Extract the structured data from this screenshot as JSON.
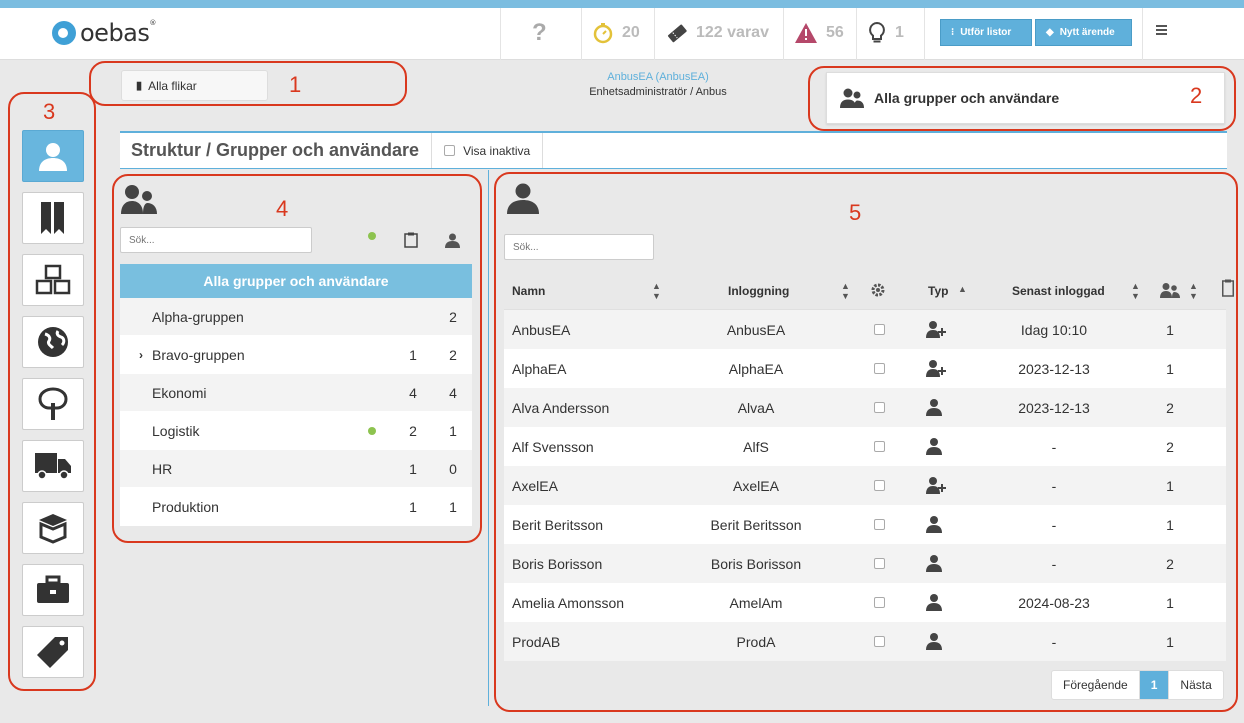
{
  "header": {
    "logo_text": "oebas",
    "logo_mark": "®",
    "help": "?",
    "timer_count": "20",
    "tickets": "122 varav",
    "alerts_count": "56",
    "ideas_count": "1",
    "btn_lists": "Utför listor",
    "btn_new_case": "Nytt ärende"
  },
  "toolbar": {
    "all_tabs": "Alla flikar",
    "user_name": "AnbusEA (AnbusEA)",
    "user_role": "Enhetsadministratör / Anbus",
    "groups_card": "Alla grupper och användare"
  },
  "page": {
    "title": "Struktur / Grupper och användare",
    "show_inactive": "Visa inaktiva"
  },
  "groups": {
    "search_placeholder": "Sök...",
    "header": "Alla grupper och användare",
    "rows": [
      {
        "name": "Alpha-gruppen",
        "c1": "",
        "c2": "2",
        "dot": false,
        "arrow": ""
      },
      {
        "name": "Bravo-gruppen",
        "c1": "1",
        "c2": "2",
        "dot": false,
        "arrow": "›"
      },
      {
        "name": "Ekonomi",
        "c1": "4",
        "c2": "4",
        "dot": false,
        "arrow": ""
      },
      {
        "name": "Logistik",
        "c1": "2",
        "c2": "1",
        "dot": true,
        "arrow": ""
      },
      {
        "name": "HR",
        "c1": "1",
        "c2": "0",
        "dot": false,
        "arrow": ""
      },
      {
        "name": "Produktion",
        "c1": "1",
        "c2": "1",
        "dot": false,
        "arrow": ""
      }
    ]
  },
  "users": {
    "search_placeholder": "Sök...",
    "columns": {
      "name": "Namn",
      "login": "Inloggning",
      "type": "Typ",
      "last_login": "Senast inloggad"
    },
    "rows": [
      {
        "name": "AnbusEA",
        "login": "AnbusEA",
        "type": "admin",
        "last": "Idag 10:10",
        "groups": "1"
      },
      {
        "name": "AlphaEA",
        "login": "AlphaEA",
        "type": "admin",
        "last": "2023-12-13",
        "groups": "1"
      },
      {
        "name": "Alva Andersson",
        "login": "AlvaA",
        "type": "user",
        "last": "2023-12-13",
        "groups": "2"
      },
      {
        "name": "Alf Svensson",
        "login": "AlfS",
        "type": "user",
        "last": "-",
        "groups": "2"
      },
      {
        "name": "AxelEA",
        "login": "AxelEA",
        "type": "admin",
        "last": "-",
        "groups": "1"
      },
      {
        "name": "Berit Beritsson",
        "login": "Berit Beritsson",
        "type": "user",
        "last": "-",
        "groups": "1"
      },
      {
        "name": "Boris Borisson",
        "login": "Boris Borisson",
        "type": "user",
        "last": "-",
        "groups": "2"
      },
      {
        "name": "Amelia Amonsson",
        "login": "AmelAm",
        "type": "user",
        "last": "2024-08-23",
        "groups": "1"
      },
      {
        "name": "ProdAB",
        "login": "ProdA",
        "type": "user",
        "last": "-",
        "groups": "1"
      }
    ]
  },
  "pager": {
    "prev": "Föregående",
    "current": "1",
    "next": "Nästa"
  },
  "annotations": [
    "1",
    "2",
    "3",
    "4",
    "5"
  ],
  "colors": {
    "accent": "#5fb0db",
    "annotation": "#d9381e",
    "online": "#8dc34f"
  }
}
